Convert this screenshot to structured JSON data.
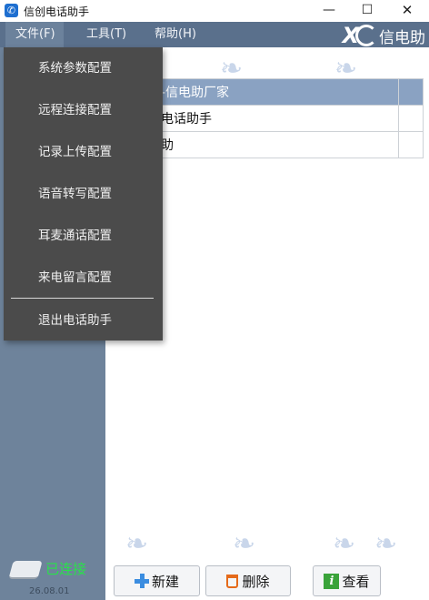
{
  "window": {
    "title": "信创电话助手",
    "minimize_glyph": "—",
    "maximize_glyph": "☐",
    "close_glyph": "✕"
  },
  "menubar": {
    "file": "文件(F)",
    "tools": "工具(T)",
    "help": "帮助(H)"
  },
  "brand": {
    "text": "信电助"
  },
  "file_menu": {
    "items": [
      "系统参数配置",
      "远程连接配置",
      "记录上传配置",
      "语音转写配置",
      "耳麦通话配置",
      "来电留言配置",
      "退出电话助手"
    ]
  },
  "table": {
    "rows": [
      {
        "name": "工-信电助厂家",
        "selected": true
      },
      {
        "name": "创电话助手",
        "selected": false
      },
      {
        "name": "电助",
        "selected": false
      }
    ]
  },
  "status": {
    "connection": "已连接",
    "connection_color": "#29e24a",
    "version": "26.08.01"
  },
  "buttons": {
    "new": "新建",
    "delete": "删除",
    "view": "查看"
  },
  "colors": {
    "menubar": "#5a708c",
    "sidebar": "#6e839b",
    "dropdown": "#4b4b4b",
    "selected_row": "#8aa2c2"
  }
}
